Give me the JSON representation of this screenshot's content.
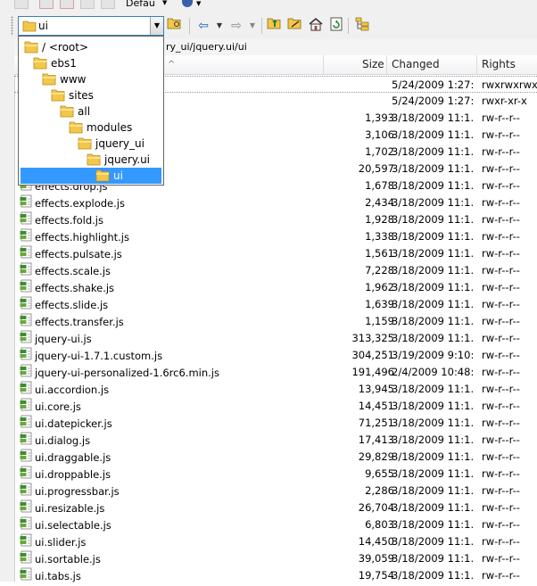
{
  "toolbar": {
    "preset_label": "Defau",
    "location_value": "ui"
  },
  "path": {
    "text": "ry_ui/jquery.ui/ui"
  },
  "columns": {
    "size": "Size",
    "changed": "Changed",
    "rights": "Rights"
  },
  "dropdown": {
    "items": [
      {
        "label": "/ <root>",
        "level": 0
      },
      {
        "label": "ebs1",
        "level": 1
      },
      {
        "label": "www",
        "level": 2
      },
      {
        "label": "sites",
        "level": 3
      },
      {
        "label": "all",
        "level": 4
      },
      {
        "label": "modules",
        "level": 5
      },
      {
        "label": "jquery_ui",
        "level": 6
      },
      {
        "label": "jquery.ui",
        "level": 7
      },
      {
        "label": "ui",
        "level": 8,
        "selected": true
      }
    ]
  },
  "files": [
    {
      "name": "",
      "size": "",
      "changed": "5/24/2009 1:27:...",
      "rights": "rwxrwxrwx",
      "type": "up"
    },
    {
      "name": "",
      "size": "",
      "changed": "5/24/2009 1:27:...",
      "rights": "rwxr-xr-x",
      "type": "folder"
    },
    {
      "name": "",
      "size": "1,393",
      "changed": "3/18/2009 11:1...",
      "rights": "rw-r--r--",
      "type": "js"
    },
    {
      "name": "",
      "size": "3,106",
      "changed": "3/18/2009 11:1...",
      "rights": "rw-r--r--",
      "type": "js"
    },
    {
      "name": "",
      "size": "1,702",
      "changed": "3/18/2009 11:1...",
      "rights": "rw-r--r--",
      "type": "js"
    },
    {
      "name": "",
      "size": "20,597",
      "changed": "3/18/2009 11:1...",
      "rights": "rw-r--r--",
      "type": "js"
    },
    {
      "name": "effects.drop.js",
      "size": "1,678",
      "changed": "3/18/2009 11:1...",
      "rights": "rw-r--r--",
      "type": "js"
    },
    {
      "name": "effects.explode.js",
      "size": "2,434",
      "changed": "3/18/2009 11:1...",
      "rights": "rw-r--r--",
      "type": "js"
    },
    {
      "name": "effects.fold.js",
      "size": "1,928",
      "changed": "3/18/2009 11:1...",
      "rights": "rw-r--r--",
      "type": "js"
    },
    {
      "name": "effects.highlight.js",
      "size": "1,338",
      "changed": "3/18/2009 11:1...",
      "rights": "rw-r--r--",
      "type": "js"
    },
    {
      "name": "effects.pulsate.js",
      "size": "1,561",
      "changed": "3/18/2009 11:1...",
      "rights": "rw-r--r--",
      "type": "js"
    },
    {
      "name": "effects.scale.js",
      "size": "7,228",
      "changed": "3/18/2009 11:1...",
      "rights": "rw-r--r--",
      "type": "js"
    },
    {
      "name": "effects.shake.js",
      "size": "1,962",
      "changed": "3/18/2009 11:1...",
      "rights": "rw-r--r--",
      "type": "js"
    },
    {
      "name": "effects.slide.js",
      "size": "1,639",
      "changed": "3/18/2009 11:1...",
      "rights": "rw-r--r--",
      "type": "js"
    },
    {
      "name": "effects.transfer.js",
      "size": "1,159",
      "changed": "3/18/2009 11:1...",
      "rights": "rw-r--r--",
      "type": "js"
    },
    {
      "name": "jquery-ui.js",
      "size": "313,325",
      "changed": "3/18/2009 11:1...",
      "rights": "rw-r--r--",
      "type": "js"
    },
    {
      "name": "jquery-ui-1.7.1.custom.js",
      "size": "304,251",
      "changed": "3/19/2009 9:10:...",
      "rights": "rw-r--r--",
      "type": "js"
    },
    {
      "name": "jquery-ui-personalized-1.6rc6.min.js",
      "size": "191,496",
      "changed": "2/4/2009 10:48:...",
      "rights": "rw-r--r--",
      "type": "js"
    },
    {
      "name": "ui.accordion.js",
      "size": "13,945",
      "changed": "3/18/2009 11:1...",
      "rights": "rw-r--r--",
      "type": "js"
    },
    {
      "name": "ui.core.js",
      "size": "14,451",
      "changed": "3/18/2009 11:1...",
      "rights": "rw-r--r--",
      "type": "js"
    },
    {
      "name": "ui.datepicker.js",
      "size": "71,251",
      "changed": "3/18/2009 11:1...",
      "rights": "rw-r--r--",
      "type": "js"
    },
    {
      "name": "ui.dialog.js",
      "size": "17,413",
      "changed": "3/18/2009 11:1...",
      "rights": "rw-r--r--",
      "type": "js"
    },
    {
      "name": "ui.draggable.js",
      "size": "29,829",
      "changed": "3/18/2009 11:1...",
      "rights": "rw-r--r--",
      "type": "js"
    },
    {
      "name": "ui.droppable.js",
      "size": "9,655",
      "changed": "3/18/2009 11:1...",
      "rights": "rw-r--r--",
      "type": "js"
    },
    {
      "name": "ui.progressbar.js",
      "size": "2,286",
      "changed": "3/18/2009 11:1...",
      "rights": "rw-r--r--",
      "type": "js"
    },
    {
      "name": "ui.resizable.js",
      "size": "26,704",
      "changed": "3/18/2009 11:1...",
      "rights": "rw-r--r--",
      "type": "js"
    },
    {
      "name": "ui.selectable.js",
      "size": "6,803",
      "changed": "3/18/2009 11:1...",
      "rights": "rw-r--r--",
      "type": "js"
    },
    {
      "name": "ui.slider.js",
      "size": "14,450",
      "changed": "3/18/2009 11:1...",
      "rights": "rw-r--r--",
      "type": "js"
    },
    {
      "name": "ui.sortable.js",
      "size": "39,059",
      "changed": "3/18/2009 11:1...",
      "rights": "rw-r--r--",
      "type": "js"
    },
    {
      "name": "ui.tabs.js",
      "size": "19,754",
      "changed": "3/18/2009 11:1...",
      "rights": "rw-r--r--",
      "type": "js"
    }
  ],
  "colors": {
    "selection": "#3399ff",
    "folder": "#f3c74a",
    "combo_border": "#3c7fb1"
  }
}
